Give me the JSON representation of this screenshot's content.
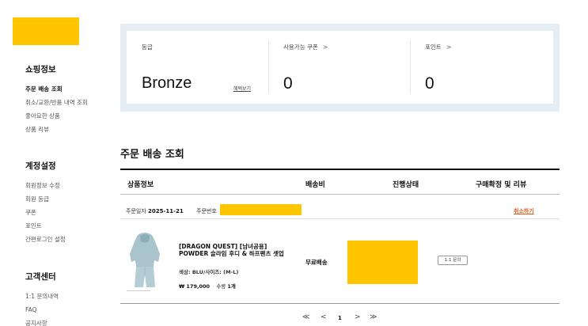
{
  "sidebar": {
    "sections": [
      {
        "title": "쇼핑정보",
        "items": [
          "주문 배송 조회",
          "취소/교환/반품 내역 조회",
          "좋아요한 상품",
          "상품 리뷰"
        ]
      },
      {
        "title": "계정설정",
        "items": [
          "회원정보 수정",
          "회원 등급",
          "쿠폰",
          "포인트",
          "간편로그인 설정"
        ]
      },
      {
        "title": "고객센터",
        "items": [
          "1:1 문의내역",
          "FAQ",
          "공지사항"
        ]
      }
    ]
  },
  "summary": {
    "grade_label": "등급",
    "grade_value": "Bronze",
    "benefit_link": "혜택보기",
    "coupon_label": "사용가능 쿠폰",
    "coupon_value": "0",
    "point_label": "포인트",
    "point_value": "0",
    "chevron": ">"
  },
  "main": {
    "title": "주문 배송 조회",
    "columns": [
      "상품정보",
      "배송비",
      "진행상태",
      "구매확정 및 리뷰"
    ],
    "order": {
      "date_label": "주문일자",
      "date_value": "2025-11-21",
      "number_label": "주문번호",
      "cancel_label": "취소하기",
      "product": {
        "name": "[DRAGON QUEST] [남녀공용] POWDER 슬라임 후디 & 하프팬츠 셋업",
        "option": "색상: BLU/사이즈: (M-L)",
        "price": "₩ 179,000",
        "qty_label": "수량",
        "qty_value": "1개",
        "shipping": "무료배송",
        "inquiry_label": "1:1 문의"
      }
    }
  },
  "pagination": {
    "first": "≪",
    "prev": "<",
    "current": "1",
    "next": ">",
    "last": "≫"
  },
  "colors": {
    "mask": "#ffc600",
    "summary_bg": "#e6eef5",
    "cancel": "#e45b1a"
  }
}
